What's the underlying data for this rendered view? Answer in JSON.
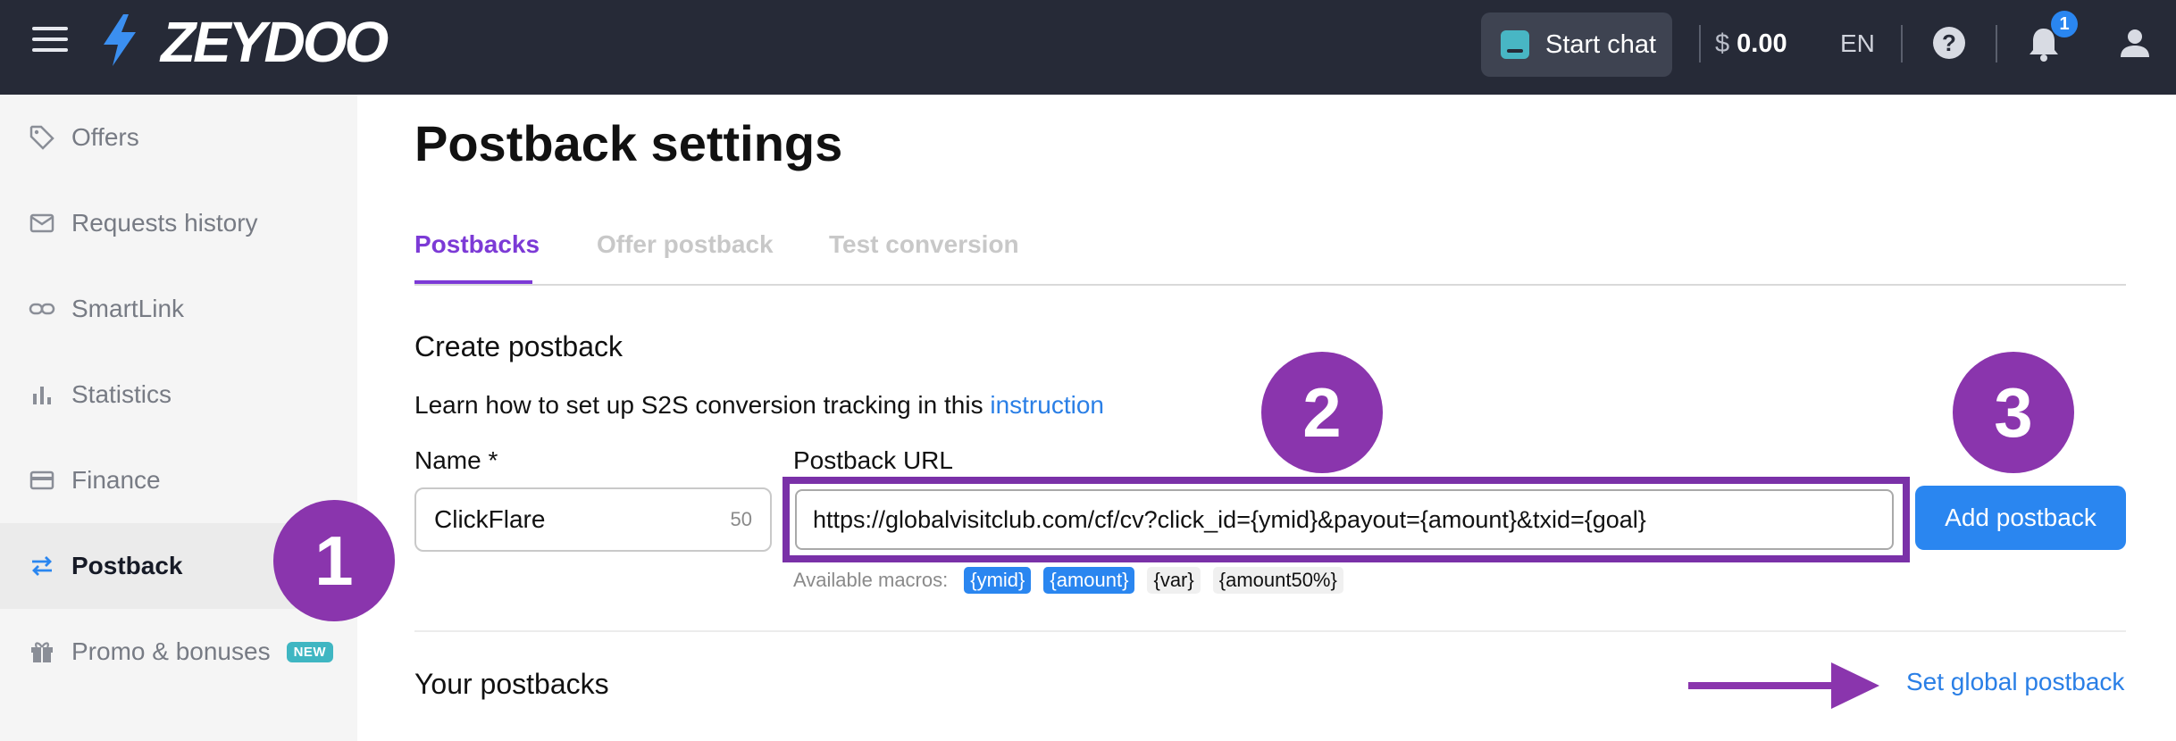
{
  "header": {
    "logo": "ZEYDOO",
    "start_chat": "Start chat",
    "currency": "$",
    "balance": "0.00",
    "language": "EN",
    "help": "?",
    "notifications_count": "1"
  },
  "sidebar": {
    "items": [
      {
        "label": "Offers",
        "icon": "tag-icon"
      },
      {
        "label": "Requests history",
        "icon": "mail-icon"
      },
      {
        "label": "SmartLink",
        "icon": "link-icon"
      },
      {
        "label": "Statistics",
        "icon": "bar-chart-icon"
      },
      {
        "label": "Finance",
        "icon": "card-icon"
      },
      {
        "label": "Postback",
        "icon": "swap-icon",
        "active": true
      },
      {
        "label": "Promo & bonuses",
        "icon": "gift-icon",
        "badge": "NEW"
      }
    ]
  },
  "main": {
    "title": "Postback settings",
    "tabs": [
      {
        "label": "Postbacks",
        "active": true
      },
      {
        "label": "Offer postback"
      },
      {
        "label": "Test conversion"
      }
    ],
    "create": {
      "title": "Create postback",
      "learn_text": "Learn how to set up S2S conversion tracking in this",
      "learn_link": "instruction",
      "name_label": "Name *",
      "name_value": "ClickFlare",
      "name_counter": "50",
      "url_label": "Postback URL",
      "url_value": "https://globalvisitclub.com/cf/cv?click_id={ymid}&payout={amount}&txid={goal}",
      "add_button": "Add postback",
      "macros_label": "Available macros:",
      "macros": [
        {
          "label": "{ymid}",
          "active": true
        },
        {
          "label": "{amount}",
          "active": true
        },
        {
          "label": "{var}",
          "active": false
        },
        {
          "label": "{amount50%}",
          "active": false
        }
      ]
    },
    "yours": {
      "title": "Your postbacks",
      "global_link": "Set global postback"
    }
  },
  "annotations": [
    "1",
    "2",
    "3"
  ],
  "colors": {
    "topbar": "#262a37",
    "accent_purple": "#7c3ad6",
    "annotation_purple": "#8a35ad",
    "primary_blue": "#2a86f0",
    "link_blue": "#2a7fe6"
  }
}
